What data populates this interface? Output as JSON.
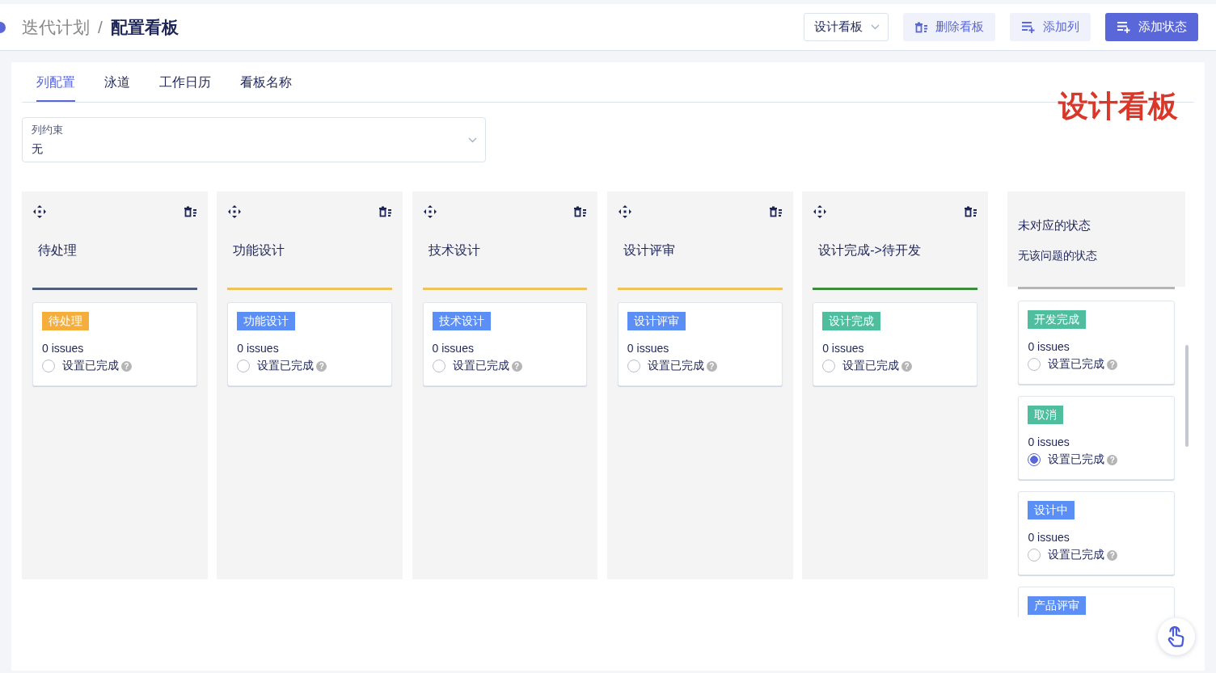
{
  "breadcrumb": {
    "items": [
      {
        "label": "迭代计划",
        "current": false
      },
      {
        "label": "配置看板",
        "current": true
      }
    ],
    "separator": "/"
  },
  "toolbar": {
    "board_select": "设计看板",
    "buttons": [
      {
        "label": "删除看板",
        "kind": "delete",
        "primary": false
      },
      {
        "label": "添加列",
        "kind": "add-column",
        "primary": false
      },
      {
        "label": "添加状态",
        "kind": "add-status",
        "primary": true
      }
    ]
  },
  "tabs": [
    {
      "label": "列配置",
      "selected": true
    },
    {
      "label": "泳道",
      "selected": false
    },
    {
      "label": "工作日历",
      "selected": false
    },
    {
      "label": "看板名称",
      "selected": false
    }
  ],
  "annotation": "设计看板",
  "constraint_field": {
    "label": "列约束",
    "value": "无"
  },
  "columns": [
    {
      "title": "待处理",
      "color": "#505f79",
      "statuses": [
        {
          "name": "待处理",
          "color": "#f5ad3b",
          "count": "0 issues",
          "done_label": "设置已完成",
          "help": "?",
          "selected": false
        }
      ]
    },
    {
      "title": "功能设计",
      "color": "#f0c35a",
      "statuses": [
        {
          "name": "功能设计",
          "color": "#5b8ff5",
          "count": "0 issues",
          "done_label": "设置已完成",
          "help": "?",
          "selected": false
        }
      ]
    },
    {
      "title": "技术设计",
      "color": "#f0c35a",
      "statuses": [
        {
          "name": "技术设计",
          "color": "#5b8ff5",
          "count": "0 issues",
          "done_label": "设置已完成",
          "help": "?",
          "selected": false
        }
      ]
    },
    {
      "title": "设计评审",
      "color": "#f0c35a",
      "statuses": [
        {
          "name": "设计评审",
          "color": "#5b8ff5",
          "count": "0 issues",
          "done_label": "设置已完成",
          "help": "?",
          "selected": false
        }
      ]
    },
    {
      "title": "设计完成->待开发",
      "color": "#3d8b3d",
      "statuses": [
        {
          "name": "设计完成",
          "color": "#4fbe9f",
          "count": "0 issues",
          "done_label": "设置已完成",
          "help": "?",
          "selected": false
        }
      ]
    }
  ],
  "unmapped": {
    "title": "未对应的状态",
    "subtitle": "无该问题的状态",
    "statuses": [
      {
        "name": "开发完成",
        "color": "#4fbe9f",
        "count": "0 issues",
        "done_label": "设置已完成",
        "help": "?",
        "selected": false
      },
      {
        "name": "取消",
        "color": "#4fbe9f",
        "count": "0 issues",
        "done_label": "设置已完成",
        "help": "?",
        "selected": true
      },
      {
        "name": "设计中",
        "color": "#5b8ff5",
        "count": "0 issues",
        "done_label": "设置已完成",
        "help": "?",
        "selected": false
      },
      {
        "name": "产品评审",
        "color": "#5b8ff5"
      }
    ]
  }
}
